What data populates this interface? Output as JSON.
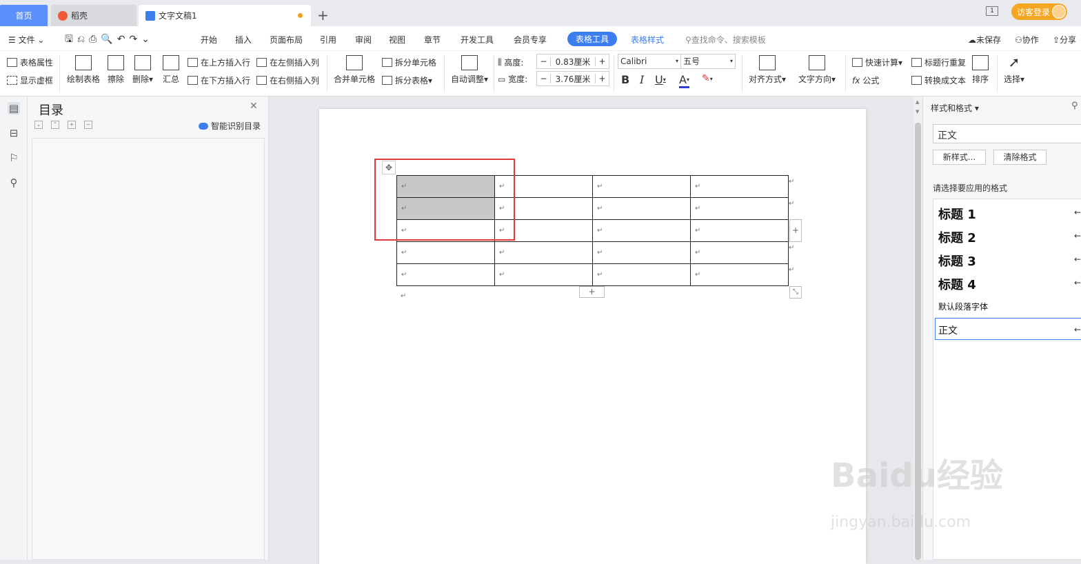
{
  "tabs": {
    "home": "首页",
    "daoke": "稻壳",
    "doc": "文字文稿1",
    "new_tab": "+"
  },
  "top_right": {
    "login": "访客登录",
    "window_badge": "1"
  },
  "menubar": {
    "file": "文件",
    "items": [
      "开始",
      "插入",
      "页面布局",
      "引用",
      "审阅",
      "视图",
      "章节",
      "开发工具",
      "会员专享",
      "表格工具",
      "表格样式"
    ],
    "search": "查找命令、搜索模板",
    "unsaved": "未保存",
    "collab": "协作",
    "share": "分享"
  },
  "ribbon": {
    "table_props": "表格属性",
    "show_grid": "显示虚框",
    "draw_table": "绘制表格",
    "erase": "擦除",
    "delete": "删除",
    "summary": "汇总",
    "insert_above": "在上方插入行",
    "insert_below": "在下方插入行",
    "insert_left": "在左侧插入列",
    "insert_right": "在右侧插入列",
    "merge": "合并单元格",
    "split_cell": "拆分单元格",
    "split_table": "拆分表格",
    "auto_fit": "自动调整",
    "height_label": "高度:",
    "height_value": "0.83厘米",
    "width_label": "宽度:",
    "width_value": "3.76厘米",
    "font": "Calibri",
    "size": "五号",
    "bold": "B",
    "italic": "I",
    "underline": "U",
    "font_color": "A",
    "align": "对齐方式",
    "text_dir": "文字方向",
    "quick_calc": "快速计算",
    "formula": "公式",
    "repeat_header": "标题行重复",
    "to_text": "转换成文本",
    "sort": "排序",
    "select": "选择"
  },
  "nav": {
    "title": "目录",
    "smart": "智能识别目录"
  },
  "document": {
    "rows": 5,
    "cols": 4,
    "selected_cells": [
      [
        0,
        0
      ],
      [
        1,
        0
      ]
    ],
    "para_mark": "↵"
  },
  "styles": {
    "header": "样式和格式",
    "current": "正文",
    "new_style": "新样式...",
    "clear": "清除格式",
    "apply_label": "请选择要应用的格式",
    "list": [
      "标题 1",
      "标题 2",
      "标题 3",
      "标题 4",
      "默认段落字体",
      "正文"
    ],
    "arrow": "←"
  },
  "watermark": {
    "line1": "Baidu经验",
    "line2": "jingyan.baidu.com"
  }
}
